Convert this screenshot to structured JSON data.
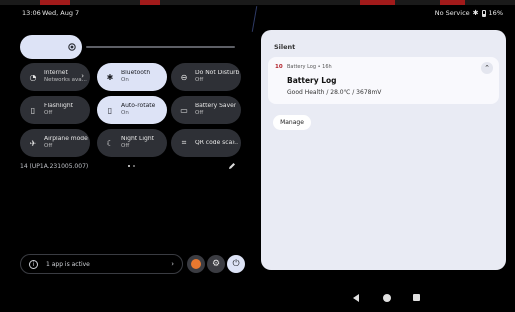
{
  "status_bar": {
    "time": "13:06",
    "date": "Wed, Aug 7",
    "network": "No Service",
    "battery": "16%"
  },
  "brightness": {
    "level": 0.0
  },
  "tiles": [
    {
      "id": "internet",
      "title": "Internet",
      "subtitle": "Networks ava...",
      "state": "off",
      "icon": "wifi-icon",
      "has_chevron": true
    },
    {
      "id": "bluetooth",
      "title": "Bluetooth",
      "subtitle": "On",
      "state": "on",
      "icon": "bluetooth-icon",
      "has_chevron": false
    },
    {
      "id": "dnd",
      "title": "Do Not Disturb",
      "subtitle": "Off",
      "state": "off",
      "icon": "dnd-icon",
      "has_chevron": false
    },
    {
      "id": "flashlight",
      "title": "Flashlight",
      "subtitle": "Off",
      "state": "off",
      "icon": "flashlight-icon",
      "has_chevron": false
    },
    {
      "id": "autorotate",
      "title": "Auto-rotate",
      "subtitle": "On",
      "state": "on",
      "icon": "rotate-icon",
      "has_chevron": false
    },
    {
      "id": "battery_saver",
      "title": "Battery Saver",
      "subtitle": "Off",
      "state": "off",
      "icon": "battery-saver-icon",
      "has_chevron": false
    },
    {
      "id": "airplane",
      "title": "Airplane mode",
      "subtitle": "Off",
      "state": "off",
      "icon": "airplane-icon",
      "has_chevron": false
    },
    {
      "id": "night_light",
      "title": "Night Light",
      "subtitle": "Off",
      "state": "off",
      "icon": "night-light-icon",
      "has_chevron": false
    },
    {
      "id": "qr",
      "title": "QR code sca...",
      "subtitle": "",
      "state": "off",
      "icon": "qr-code-icon",
      "has_chevron": true
    }
  ],
  "build_number": "14 (UP1A.231005.007)",
  "page_dots": {
    "count": 2,
    "active": 0
  },
  "active_apps": {
    "label": "1 app is active"
  },
  "notifications": {
    "section_label": "Silent",
    "items": [
      {
        "app_badge": "10",
        "meta": "Battery Log • 16h",
        "title": "Battery Log",
        "body": "Good Health / 28.0℃ / 3678mV"
      }
    ],
    "manage_label": "Manage"
  },
  "colors": {
    "tile_on": "#dde3f6",
    "tile_off": "#2e3036",
    "panel_bg": "#e9ebf4",
    "accent_orange": "#e9782f"
  }
}
